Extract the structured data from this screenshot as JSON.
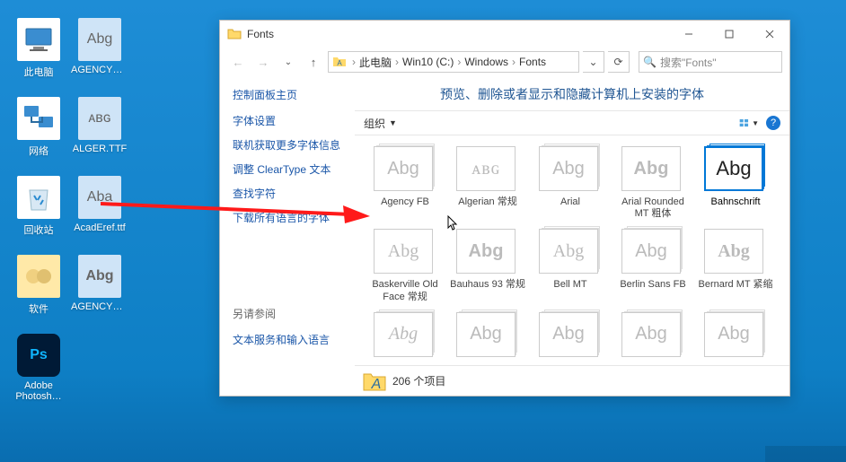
{
  "desktop": {
    "icons": [
      {
        "label": "此电脑",
        "glyph": "pc"
      },
      {
        "label": "AGENCYR…",
        "glyph": "Abg"
      },
      {
        "label": "网络",
        "glyph": "net"
      },
      {
        "label": "ALGER.TTF",
        "glyph": "ᴀʙɢ"
      },
      {
        "label": "回收站",
        "glyph": "bin"
      },
      {
        "label": "AcadEref.ttf",
        "glyph": "Aba"
      },
      {
        "label": "软件",
        "glyph": "folder"
      },
      {
        "label": "AGENCYB…",
        "glyph": "Abg"
      },
      {
        "label": "Adobe Photosh…",
        "glyph": "Ps"
      }
    ]
  },
  "window": {
    "title": "Fonts",
    "breadcrumb": [
      "此电脑",
      "Win10 (C:)",
      "Windows",
      "Fonts"
    ],
    "search_placeholder": "搜索\"Fonts\"",
    "sidebar": {
      "title": "控制面板主页",
      "links": [
        "字体设置",
        "联机获取更多字体信息",
        "调整 ClearType 文本",
        "查找字符",
        "下载所有语言的字体"
      ],
      "bottom_title": "另请参阅",
      "bottom_links": [
        "文本服务和输入语言"
      ]
    },
    "main_header": "预览、删除或者显示和隐藏计算机上安装的字体",
    "toolbar": {
      "organize": "组织"
    },
    "fonts": [
      {
        "name": "Agency FB",
        "sample": "Abg",
        "stack": true,
        "style": ""
      },
      {
        "name": "Algerian 常规",
        "sample": "ᴀʙɢ",
        "stack": false,
        "style": "font-family:serif;letter-spacing:1px"
      },
      {
        "name": "Arial",
        "sample": "Abg",
        "stack": true,
        "style": ""
      },
      {
        "name": "Arial Rounded MT 粗体",
        "sample": "Abg",
        "stack": false,
        "style": "font-weight:bold"
      },
      {
        "name": "Bahnschrift",
        "sample": "Abg",
        "stack": true,
        "style": "",
        "selected": true
      },
      {
        "name": "Baskerville Old Face 常规",
        "sample": "Abg",
        "stack": false,
        "style": "font-family:serif"
      },
      {
        "name": "Bauhaus 93 常规",
        "sample": "Abg",
        "stack": false,
        "style": "font-weight:900"
      },
      {
        "name": "Bell MT",
        "sample": "Abg",
        "stack": true,
        "style": "font-family:serif"
      },
      {
        "name": "Berlin Sans FB",
        "sample": "Abg",
        "stack": true,
        "style": ""
      },
      {
        "name": "Bernard MT 紧缩",
        "sample": "Abg",
        "stack": false,
        "style": "font-family:serif;font-weight:bold"
      },
      {
        "name": "",
        "sample": "Abg",
        "stack": true,
        "style": "font-style:italic;font-family:cursive"
      },
      {
        "name": "",
        "sample": "Abg",
        "stack": true,
        "style": ""
      },
      {
        "name": "",
        "sample": "Abg",
        "stack": true,
        "style": ""
      },
      {
        "name": "",
        "sample": "Abg",
        "stack": true,
        "style": ""
      },
      {
        "name": "",
        "sample": "Abg",
        "stack": true,
        "style": ""
      }
    ],
    "status": "206 个项目"
  }
}
